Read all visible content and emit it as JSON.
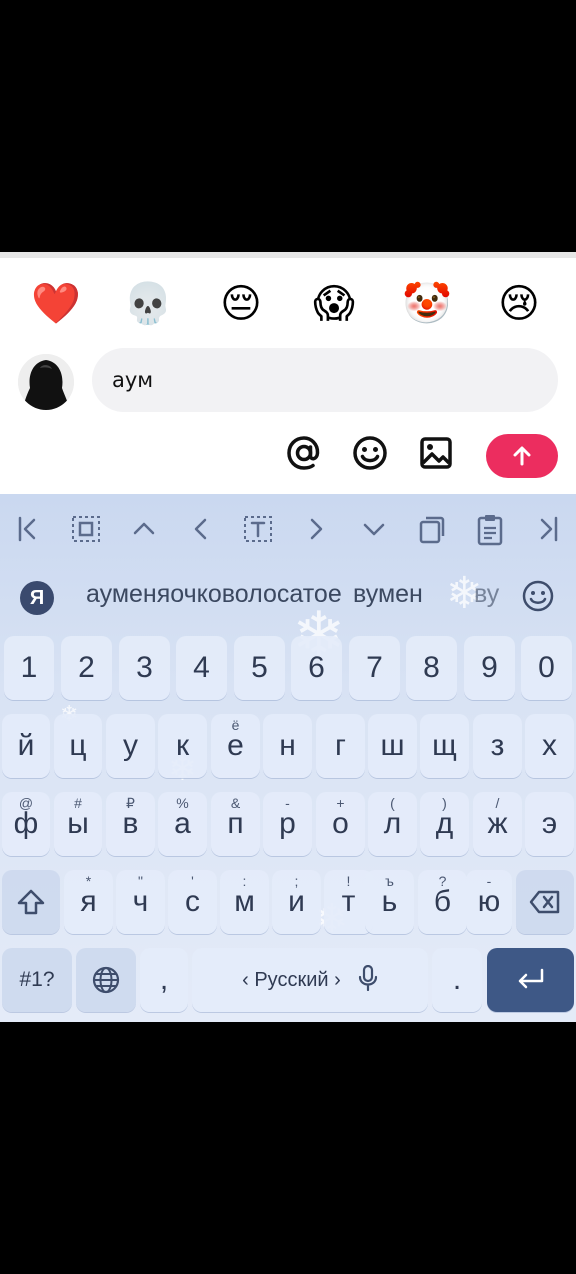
{
  "reactions": [
    {
      "name": "heart",
      "glyph": "❤️"
    },
    {
      "name": "skull",
      "glyph": "💀"
    },
    {
      "name": "pensive-face",
      "glyph": "😔"
    },
    {
      "name": "screaming-face",
      "glyph": "😱"
    },
    {
      "name": "clown-face",
      "glyph": "🤡"
    },
    {
      "name": "crying-face",
      "glyph": "😢"
    }
  ],
  "composer": {
    "text": "аум",
    "avatar_icon": "hooded-figure-avatar"
  },
  "actions": {
    "mention_icon": "at-icon",
    "emoji_icon": "smiley-icon",
    "image_icon": "image-icon",
    "send_icon": "arrow-up-icon",
    "send_color": "#ec2d5f"
  },
  "keyboard": {
    "toolbar_icons": [
      "cursor-start-icon",
      "select-all-icon",
      "arrow-up-icon",
      "arrow-left-icon",
      "text-select-icon",
      "arrow-right-icon",
      "arrow-down-icon",
      "copy-icon",
      "clipboard-icon",
      "cursor-end-icon"
    ],
    "logo": "Я",
    "suggestions": [
      "ауменяочковолосатое",
      "вумен",
      "ву"
    ],
    "digits": [
      "1",
      "2",
      "3",
      "4",
      "5",
      "6",
      "7",
      "8",
      "9",
      "0"
    ],
    "row1": [
      {
        "main": "й",
        "sub": ""
      },
      {
        "main": "ц",
        "sub": ""
      },
      {
        "main": "у",
        "sub": ""
      },
      {
        "main": "к",
        "sub": ""
      },
      {
        "main": "е",
        "sub": "ё"
      },
      {
        "main": "н",
        "sub": ""
      },
      {
        "main": "г",
        "sub": ""
      },
      {
        "main": "ш",
        "sub": ""
      },
      {
        "main": "щ",
        "sub": ""
      },
      {
        "main": "з",
        "sub": ""
      },
      {
        "main": "х",
        "sub": ""
      }
    ],
    "row2": [
      {
        "main": "ф",
        "sub": "@"
      },
      {
        "main": "ы",
        "sub": "#"
      },
      {
        "main": "в",
        "sub": "₽"
      },
      {
        "main": "а",
        "sub": "%"
      },
      {
        "main": "п",
        "sub": "&"
      },
      {
        "main": "р",
        "sub": "-"
      },
      {
        "main": "о",
        "sub": "+"
      },
      {
        "main": "л",
        "sub": "("
      },
      {
        "main": "д",
        "sub": ")"
      },
      {
        "main": "ж",
        "sub": "/"
      },
      {
        "main": "э",
        "sub": ""
      }
    ],
    "row3": [
      {
        "main": "я",
        "sub": "*"
      },
      {
        "main": "ч",
        "sub": "\""
      },
      {
        "main": "с",
        "sub": "'"
      },
      {
        "main": "м",
        "sub": ":"
      },
      {
        "main": "и",
        "sub": ";"
      },
      {
        "main": "т",
        "sub": "!"
      },
      {
        "main": "ь",
        "sub": "ъ"
      },
      {
        "main": "б",
        "sub": "?"
      },
      {
        "main": "ю",
        "sub": "-"
      }
    ],
    "shift_icon": "shift-icon",
    "backspace_icon": "backspace-icon",
    "symbols_label": "#1?",
    "globe_icon": "globe-icon",
    "comma": ",",
    "space_left_chevron": "‹",
    "space_label": "Русский",
    "space_right_chevron": "›",
    "mic_icon": "microphone-icon",
    "period": ".",
    "enter_icon": "enter-icon",
    "enter_color": "#3e5886"
  }
}
